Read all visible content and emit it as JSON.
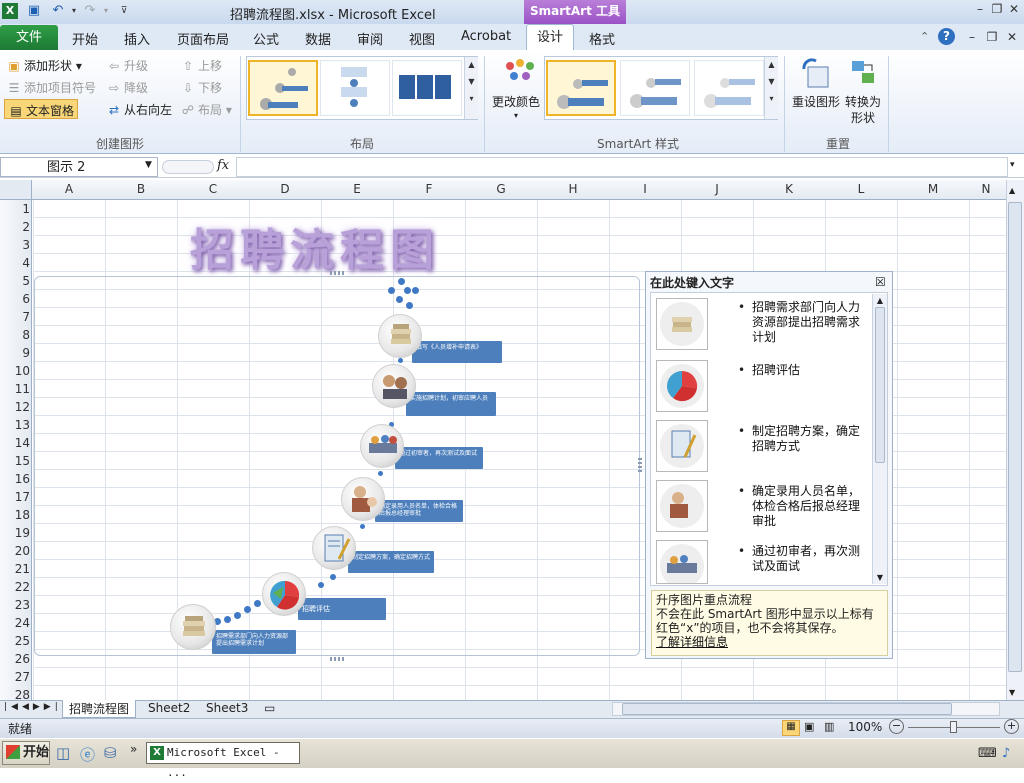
{
  "window": {
    "title": "招聘流程图.xlsx - Microsoft Excel",
    "context_tab": "SmartArt 工具"
  },
  "tabs": [
    {
      "label": "开始"
    },
    {
      "label": "插入"
    },
    {
      "label": "页面布局"
    },
    {
      "label": "公式"
    },
    {
      "label": "数据"
    },
    {
      "label": "审阅"
    },
    {
      "label": "视图"
    },
    {
      "label": "Acrobat"
    },
    {
      "label": "设计"
    },
    {
      "label": "格式"
    }
  ],
  "file_tab": "文件",
  "ribbon": {
    "create": {
      "add_shape": "添加形状",
      "add_bullet": "添加项目符号",
      "text_pane": "文本窗格",
      "promote": "升级",
      "demote": "降级",
      "rtl": "从右向左",
      "move_up": "上移",
      "move_down": "下移",
      "layout": "布局",
      "group_label": "创建图形"
    },
    "layout_group_label": "布局",
    "change_colors": "更改颜色",
    "styles_group_label": "SmartArt 样式",
    "reset": {
      "reset_graphic": "重设图形",
      "convert": "转换为",
      "convert2": "形状",
      "group_label": "重置"
    }
  },
  "formula": {
    "name_box": "图示 2",
    "fx": "fx",
    "value": ""
  },
  "columns": [
    "A",
    "B",
    "C",
    "D",
    "E",
    "F",
    "G",
    "H",
    "I",
    "J",
    "K",
    "L",
    "M",
    "N"
  ],
  "rows": [
    "1",
    "2",
    "3",
    "4",
    "5",
    "6",
    "7",
    "8",
    "9",
    "10",
    "11",
    "12",
    "13",
    "14",
    "15",
    "16",
    "17",
    "18",
    "19",
    "20",
    "21",
    "22",
    "23",
    "24",
    "25",
    "26",
    "27",
    "28"
  ],
  "wordart": "招聘流程图",
  "smartart_steps": [
    {
      "text": "填写《人员增补申请表》"
    },
    {
      "text": "实施招聘计划，初审应聘人员"
    },
    {
      "text": "通过初审者，再次测试及面试"
    },
    {
      "text": "确定录用人员名单，体检合格后报总经理审批"
    },
    {
      "text": "制定招聘方案，确定招聘方式"
    },
    {
      "text": "招聘评估"
    },
    {
      "text": "招聘需求部门向人力资源部提出招聘需求计划"
    }
  ],
  "text_pane": {
    "title": "在此处键入文字",
    "items": [
      {
        "text": "招聘需求部门向人力资源部提出招聘需求计划"
      },
      {
        "text": "招聘评估"
      },
      {
        "text": "制定招聘方案，确定招聘方式"
      },
      {
        "text": "确定录用人员名单，体检合格后报总经理审批"
      },
      {
        "text": "通过初审者，再次测试及面试"
      }
    ],
    "hint_title": "升序图片重点流程",
    "hint_body": "不会在此 SmartArt 图形中显示以上标有红色“x”的项目，也不会将其保存。",
    "hint_link": "了解详细信息"
  },
  "sheets": [
    {
      "label": "招聘流程图"
    },
    {
      "label": "Sheet2"
    },
    {
      "label": "Sheet3"
    }
  ],
  "status": {
    "ready": "就绪",
    "zoom": "100%"
  },
  "taskbar": {
    "start": "开始",
    "app": "Microsoft Excel - ..."
  }
}
